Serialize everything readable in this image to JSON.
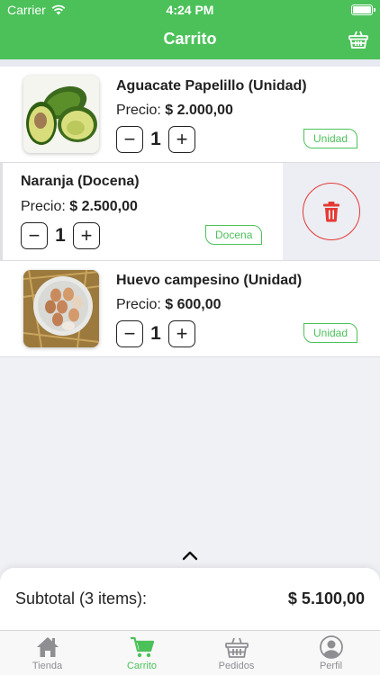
{
  "status_bar": {
    "carrier": "Carrier",
    "time": "4:24 PM"
  },
  "header": {
    "title": "Carrito",
    "basket_icon": "basket-icon"
  },
  "price_label": "Precio:",
  "items": [
    {
      "name": "Aguacate Papelillo (Unidad)",
      "price": "$ 2.000,00",
      "quantity": "1",
      "unit": "Unidad",
      "image": "avocado-image"
    },
    {
      "name": "Naranja (Docena)",
      "price": "$ 2.500,00",
      "quantity": "1",
      "unit": "Docena",
      "image": "orange-image"
    },
    {
      "name": "Huevo campesino (Unidad)",
      "price": "$ 600,00",
      "quantity": "1",
      "unit": "Unidad",
      "image": "eggs-image"
    }
  ],
  "stepper": {
    "minus": "−",
    "plus": "+"
  },
  "subtotal": {
    "label": "Subtotal (3 items):",
    "value": "$ 5.100,00"
  },
  "tabs": [
    {
      "label": "Tienda",
      "icon": "home-icon"
    },
    {
      "label": "Carrito",
      "icon": "cart-icon",
      "active": true
    },
    {
      "label": "Pedidos",
      "icon": "basket-icon"
    },
    {
      "label": "Perfil",
      "icon": "profile-icon"
    }
  ],
  "colors": {
    "accent": "#4cc15a",
    "delete": "#e53935",
    "inactive": "#8e8e93"
  }
}
